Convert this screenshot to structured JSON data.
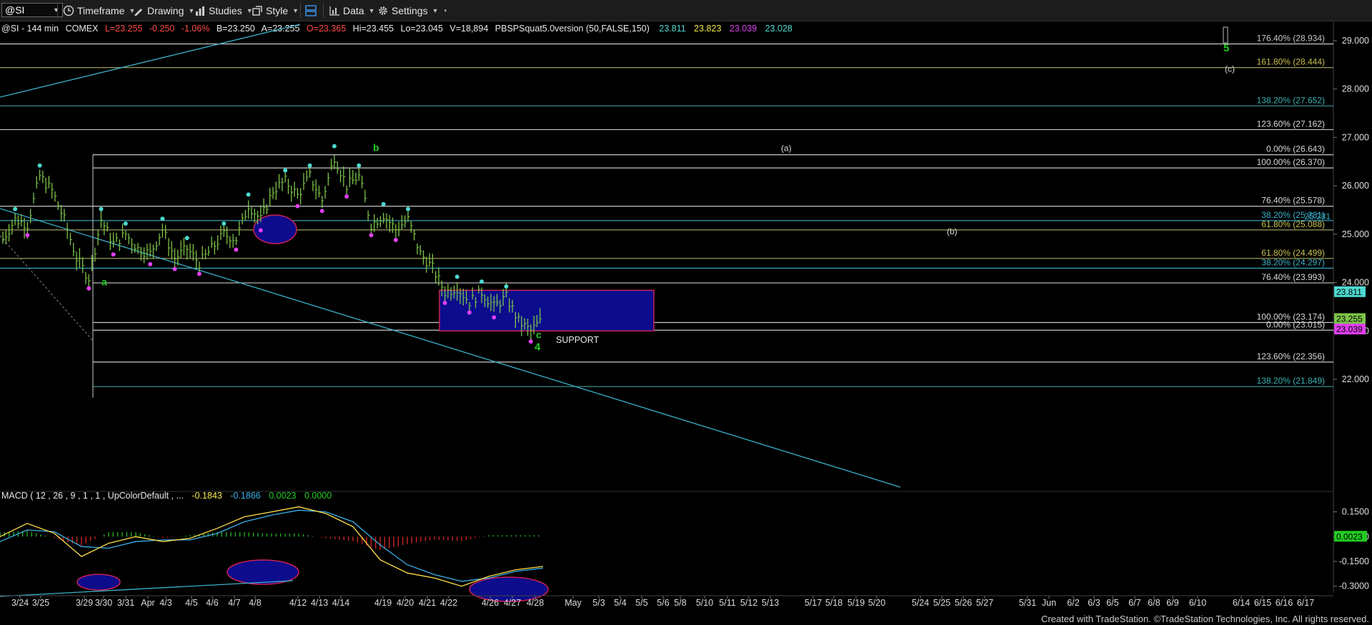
{
  "toolbar": {
    "symbol": "@SI",
    "timeframe": "Timeframe",
    "drawing": "Drawing",
    "studies": "Studies",
    "style": "Style",
    "data": "Data",
    "settings": "Settings"
  },
  "header": {
    "symbol": "@SI - 144 min",
    "exchange": "COMEX",
    "last": "L=23.255",
    "change": "-0.250",
    "pct": "-1.06%",
    "bid": "B=23.250",
    "ask": "A=23.255",
    "open": "O=23.365",
    "high": "Hi=23.455",
    "low": "Lo=23.045",
    "volume": "V=18,894",
    "indicator": "PBSPSquat5.0version (50,FALSE,150)",
    "ind_values": [
      "23.811",
      "23.823",
      "23.039",
      "23.028"
    ]
  },
  "macd_header": {
    "label": "MACD ( 12 , 26 , 9 , 1 , 1 , UpColorDefault , ...",
    "values": [
      "-0.1843",
      "-0.1866",
      "0.0023",
      "0.0000"
    ]
  },
  "footer": "Created with TradeStation. ©TradeStation Technologies, Inc. All rights reserved.",
  "colors": {
    "background": "#000000",
    "bars": "#7cc44a",
    "cyan": "#4dd9d0",
    "magenta": "#e040f0",
    "support_box": "#0c0c8c",
    "support_border": "#cc2255",
    "wave_label": "#22cc22",
    "trendline": "#3ab0c8",
    "macd_line": "#ffe04a",
    "signal_line": "#3ab0e8"
  },
  "chart_data": {
    "type": "line",
    "title": "@SI - 144 min",
    "ylim": [
      21.6,
      29.4
    ],
    "y_ticks": [
      "29.000",
      "28.000",
      "27.000",
      "26.000",
      "25.000",
      "24.000",
      "23.000",
      "22.000"
    ],
    "x_tick_labels": [
      "3/24",
      "3/25",
      "3/29",
      "3/30",
      "3/31",
      "Apr",
      "4/3",
      "4/5",
      "4/6",
      "4/7",
      "4/8",
      "4/12",
      "4/13",
      "4/14",
      "4/19",
      "4/20",
      "4/21",
      "4/22",
      "4/26",
      "4/27",
      "4/28",
      "May",
      "5/3",
      "5/4",
      "5/5",
      "5/6",
      "5/8",
      "5/10",
      "5/11",
      "5/12",
      "5/13",
      "5/17",
      "5/18",
      "5/19",
      "5/20",
      "5/24",
      "5/25",
      "5/26",
      "5/27",
      "5/31",
      "Jun",
      "6/2",
      "6/3",
      "6/5",
      "6/7",
      "6/8",
      "6/9",
      "6/10",
      "6/14",
      "6/15",
      "6/16",
      "6/17"
    ],
    "series": [
      {
        "name": "@SI",
        "values": [
          24.9,
          25.3,
          25.2,
          26.2,
          25.9,
          25.3,
          24.5,
          24.1,
          25.3,
          24.8,
          25.0,
          24.7,
          24.6,
          25.1,
          24.5,
          24.7,
          24.4,
          24.7,
          25.0,
          24.9,
          25.6,
          25.3,
          25.9,
          26.1,
          25.8,
          26.2,
          25.7,
          26.6,
          26.0,
          26.2,
          25.2,
          25.4,
          25.1,
          25.3,
          24.6,
          24.3,
          23.8,
          23.9,
          23.6,
          23.8,
          23.5,
          23.7,
          23.2,
          23.0,
          23.25
        ]
      }
    ],
    "fib_levels": [
      {
        "label": "176.40%",
        "value": "(28.934)",
        "y": 28.934
      },
      {
        "label": "161.80%",
        "value": "(28.444)",
        "y": 28.444
      },
      {
        "label": "138.20%",
        "value": "(27.652)",
        "y": 27.652
      },
      {
        "label": "123.60%",
        "value": "(27.162)",
        "y": 27.162
      },
      {
        "label": "0.00%",
        "value": "(26.643)",
        "y": 26.643
      },
      {
        "label": "100.00%",
        "value": "(26.370)",
        "y": 26.37
      },
      {
        "label": "76.40%",
        "value": "(25.578)",
        "y": 25.578
      },
      {
        "label": "38.20%",
        "value": "(25.281)",
        "y": 25.281
      },
      {
        "label": "61.80%",
        "value": "(25.088)",
        "y": 25.088
      },
      {
        "label": "61.80%",
        "value": "(24.499)",
        "y": 24.499
      },
      {
        "label": "38.20%",
        "value": "(24.297)",
        "y": 24.297
      },
      {
        "label": "76.40%",
        "value": "(23.993)",
        "y": 23.993
      },
      {
        "label": "100.00%",
        "value": "(23.174)",
        "y": 23.174
      },
      {
        "label": "0.00%",
        "value": "(23.015)",
        "y": 23.015
      },
      {
        "label": "123.60%",
        "value": "(22.356)",
        "y": 22.356
      },
      {
        "label": "138.20%",
        "value": "(21.849)",
        "y": 21.849
      }
    ],
    "price_markers": [
      {
        "value": "25.281",
        "y": 25.281
      },
      {
        "value": "23.811",
        "y": 23.811
      },
      {
        "value": "23.255",
        "y": 23.255
      },
      {
        "value": "23.039",
        "y": 23.039
      }
    ],
    "wave_labels": [
      "a",
      "b",
      "c",
      "4",
      "5",
      "(a)",
      "(b)",
      "(c)"
    ],
    "support_zone": {
      "label": "SUPPORT",
      "top": 23.84,
      "bottom": 23.0
    },
    "macd": {
      "ylim": [
        -0.34,
        0.2
      ],
      "y_ticks": [
        "0.1500",
        "0.0000",
        "-0.1500",
        "-0.3000"
      ],
      "current": "0.0023",
      "macd_values": [
        0.0,
        0.08,
        0.02,
        -0.12,
        -0.04,
        0.0,
        -0.03,
        -0.01,
        0.05,
        0.12,
        0.15,
        0.18,
        0.14,
        0.06,
        -0.14,
        -0.22,
        -0.25,
        -0.3,
        -0.24,
        -0.2,
        -0.18
      ],
      "signal_values": [
        -0.03,
        0.04,
        0.03,
        -0.06,
        -0.07,
        -0.03,
        -0.02,
        -0.02,
        0.02,
        0.09,
        0.13,
        0.16,
        0.15,
        0.09,
        -0.05,
        -0.17,
        -0.23,
        -0.27,
        -0.25,
        -0.21,
        -0.19
      ]
    }
  }
}
